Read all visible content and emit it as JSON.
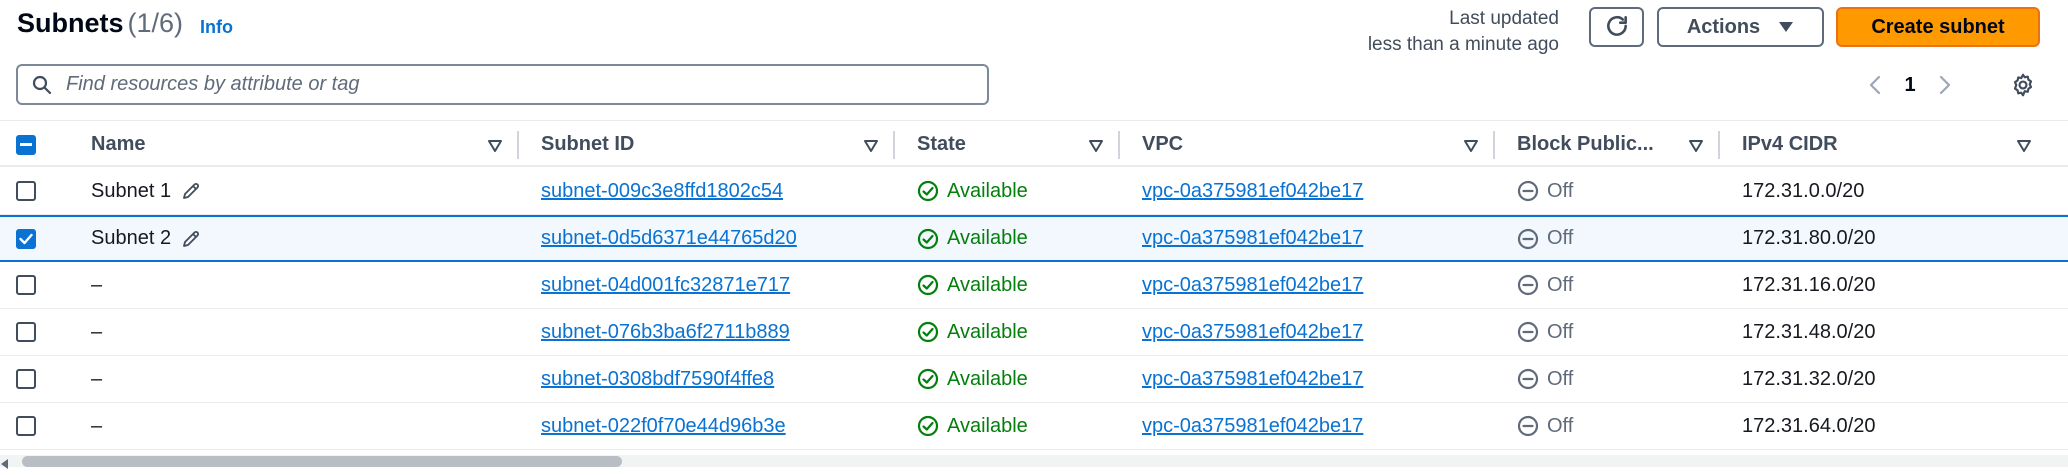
{
  "header": {
    "title": "Subnets",
    "count": "(1/6)",
    "info_label": "Info",
    "last_updated_label": "Last updated",
    "last_updated_value": "less than a minute ago",
    "actions_label": "Actions",
    "create_label": "Create subnet"
  },
  "search": {
    "placeholder": "Find resources by attribute or tag",
    "value": ""
  },
  "pagination": {
    "current_page": "1"
  },
  "table": {
    "columns": [
      "Name",
      "Subnet ID",
      "State",
      "VPC",
      "Block Public...",
      "IPv4 CIDR"
    ],
    "rows": [
      {
        "selected": false,
        "name": "Subnet 1",
        "subnet_id": "subnet-009c3e8ffd1802c54",
        "state": "Available",
        "vpc": "vpc-0a375981ef042be17",
        "block_public": "Off",
        "ipv4_cidr": "172.31.0.0/20"
      },
      {
        "selected": true,
        "name": "Subnet 2",
        "subnet_id": "subnet-0d5d6371e44765d20",
        "state": "Available",
        "vpc": "vpc-0a375981ef042be17",
        "block_public": "Off",
        "ipv4_cidr": "172.31.80.0/20"
      },
      {
        "selected": false,
        "name": "–",
        "subnet_id": "subnet-04d001fc32871e717",
        "state": "Available",
        "vpc": "vpc-0a375981ef042be17",
        "block_public": "Off",
        "ipv4_cidr": "172.31.16.0/20"
      },
      {
        "selected": false,
        "name": "–",
        "subnet_id": "subnet-076b3ba6f2711b889",
        "state": "Available",
        "vpc": "vpc-0a375981ef042be17",
        "block_public": "Off",
        "ipv4_cidr": "172.31.48.0/20"
      },
      {
        "selected": false,
        "name": "–",
        "subnet_id": "subnet-0308bdf7590f4ffe8",
        "state": "Available",
        "vpc": "vpc-0a375981ef042be17",
        "block_public": "Off",
        "ipv4_cidr": "172.31.32.0/20"
      },
      {
        "selected": false,
        "name": "–",
        "subnet_id": "subnet-022f0f70e44d96b3e",
        "state": "Available",
        "vpc": "vpc-0a375981ef042be17",
        "block_public": "Off",
        "ipv4_cidr": "172.31.64.0/20"
      }
    ]
  },
  "colors": {
    "primary_button": "#ff9900",
    "link": "#0972d3",
    "available": "#037f0c",
    "selected_row": "#f2f8fd"
  },
  "icons": {
    "refresh": "refresh-icon",
    "actions_caret": "caret-down-icon",
    "search": "search-icon",
    "pager_prev": "chevron-left-icon",
    "pager_next": "chevron-right-icon",
    "settings": "gear-icon",
    "sort": "sort-caret-icon",
    "edit": "pencil-icon",
    "available": "check-circle-icon",
    "off": "minus-circle-icon"
  }
}
